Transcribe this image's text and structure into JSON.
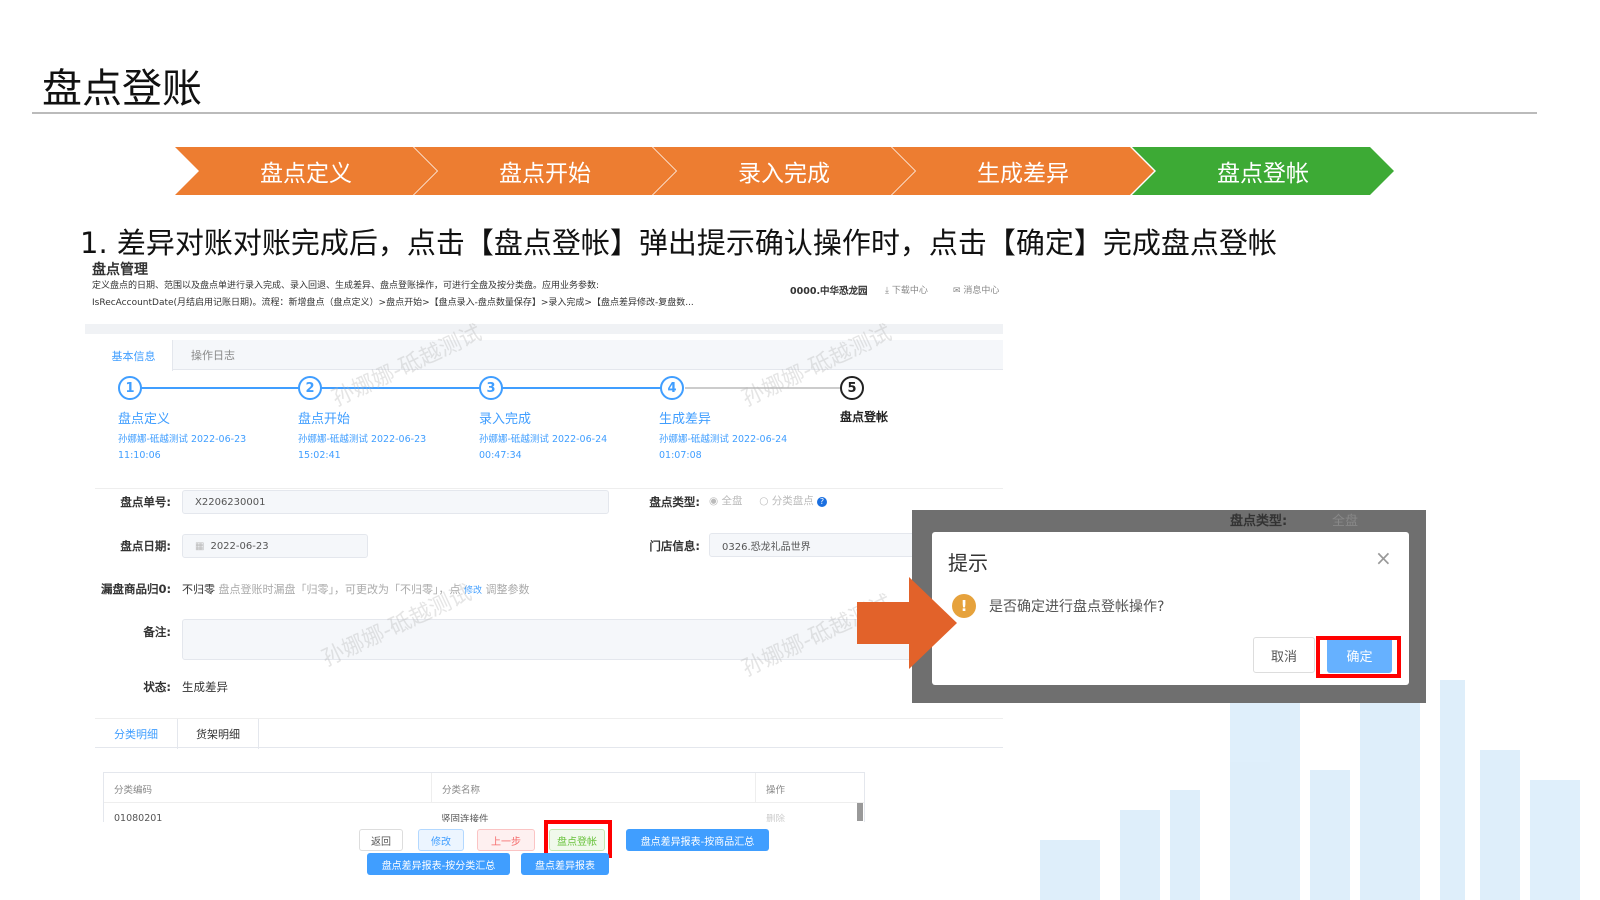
{
  "slide": {
    "title": "盘点登账",
    "instruction": "1.  差异对账对账完成后，点击【盘点登帐】弹出提示确认操作时，点击【确定】完成盘点登帐"
  },
  "process": [
    {
      "label": "盘点定义",
      "color": "#ed7d31"
    },
    {
      "label": "盘点开始",
      "color": "#ed7d31"
    },
    {
      "label": "录入完成",
      "color": "#ed7d31"
    },
    {
      "label": "生成差异",
      "color": "#ed7d31"
    },
    {
      "label": "盘点登帐",
      "color": "#3daa35"
    }
  ],
  "app": {
    "title": "盘点管理",
    "desc1": "定义盘点的日期、范围以及盘点单进行录入完成、录入回退、生成差异、盘点登账操作，可进行全盘及按分类盘。应用业务参数:",
    "desc2": "IsRecAccountDate(月结启用记账日期)。流程：新增盘点（盘点定义）>盘点开始>【盘点录入-盘点数量保存】>录入完成>【盘点差异修改-复盘数...",
    "store": "0000.中华恐龙园",
    "download": "下载中心",
    "message": "消息中心",
    "tabs": [
      "基本信息",
      "操作日志"
    ],
    "steps": [
      {
        "num": "1",
        "label": "盘点定义",
        "user": "孙娜娜-砥越测试 2022-06-23",
        "time": "11:10:06"
      },
      {
        "num": "2",
        "label": "盘点开始",
        "user": "孙娜娜-砥越测试 2022-06-23",
        "time": "15:02:41"
      },
      {
        "num": "3",
        "label": "录入完成",
        "user": "孙娜娜-砥越测试 2022-06-24",
        "time": "00:47:34"
      },
      {
        "num": "4",
        "label": "生成差异",
        "user": "孙娜娜-砥越测试 2022-06-24",
        "time": "01:07:08"
      },
      {
        "num": "5",
        "label": "盘点登帐"
      }
    ],
    "form": {
      "no_label": "盘点单号:",
      "no_value": "X2206230001",
      "type_label": "盘点类型:",
      "type_all": "全盘",
      "type_cat": "分类盘点",
      "date_label": "盘点日期:",
      "date_value": "2022-06-23",
      "store_label": "门店信息:",
      "store_value": "0326.恐龙礼品世界",
      "zero_label": "漏盘商品归0:",
      "zero_value": "不归零",
      "zero_hint1": "盘点登账时漏盘「归零」，可更改为「不归零」，点",
      "zero_link": "修改",
      "zero_hint2": "调整参数",
      "remark_label": "备注:",
      "status_label": "状态:",
      "status_value": "生成差异"
    },
    "subtabs": [
      "分类明细",
      "货架明细"
    ],
    "table": {
      "headers": [
        "分类编码",
        "分类名称",
        "操作"
      ],
      "rows": [
        [
          "01080201",
          "竖固连接件",
          "删除"
        ]
      ]
    },
    "buttons": {
      "back": "返回",
      "edit": "修改",
      "prev": "上一步",
      "post": "盘点登帐",
      "report_goods": "盘点差异报表-按商品汇总",
      "report_cat": "盘点差异报表-按分类汇总",
      "report": "盘点差异报表"
    },
    "watermark": "孙娜娜-砥越测试"
  },
  "dialog": {
    "title": "提示",
    "message": "是否确定进行盘点登帐操作?",
    "cancel": "取消",
    "ok": "确定",
    "bg_label": "盘点类型:",
    "bg_option": "全盘"
  }
}
